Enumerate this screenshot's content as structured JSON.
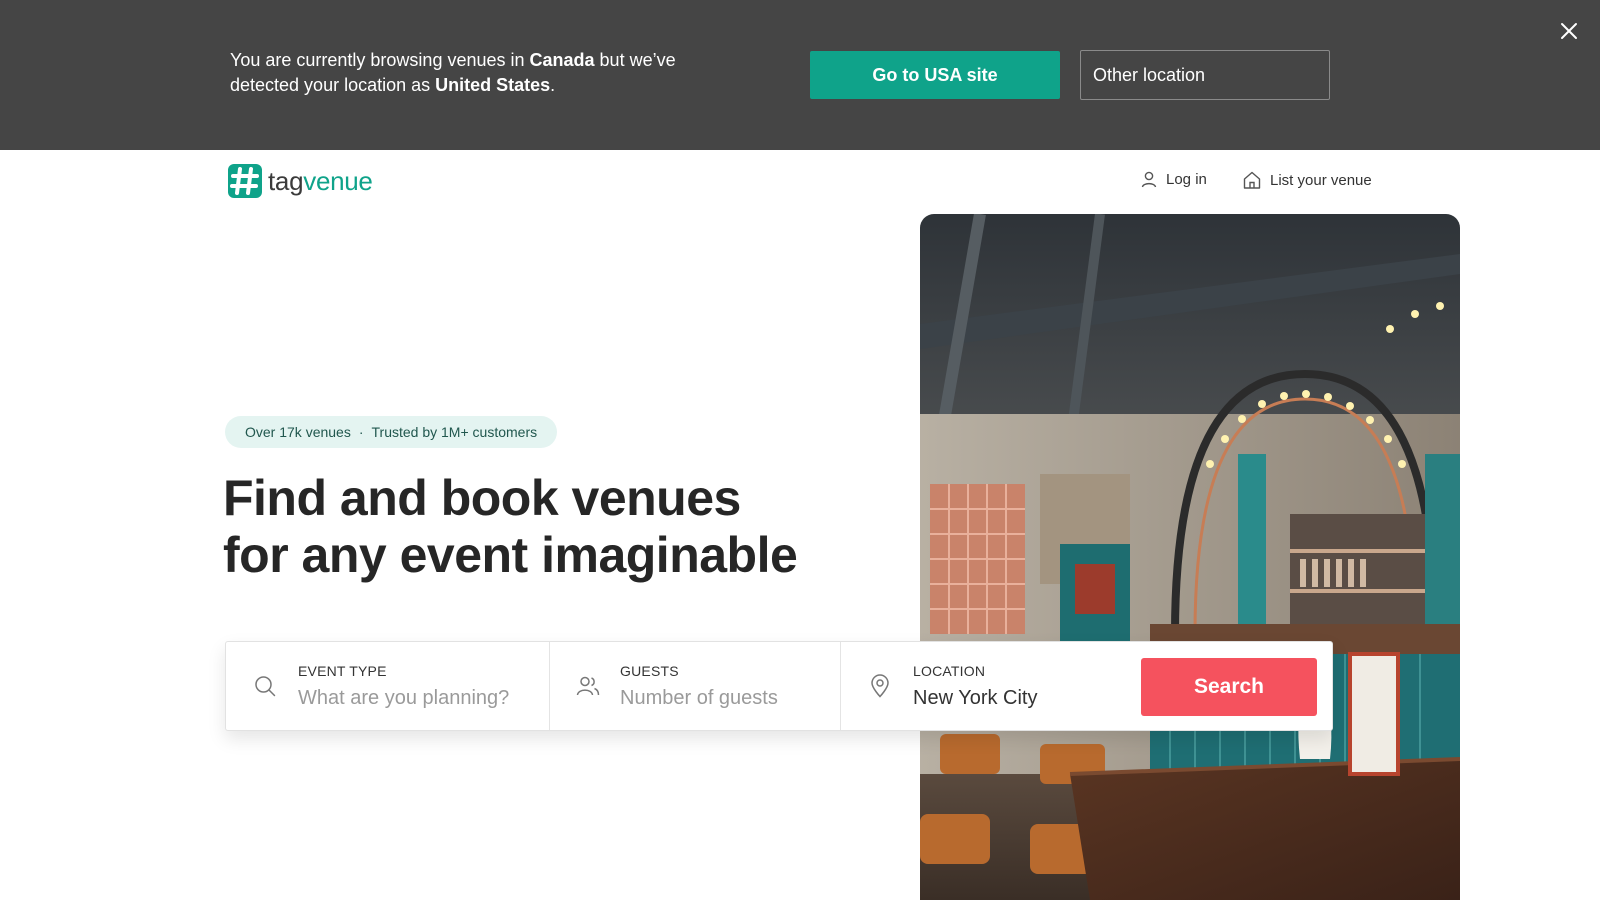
{
  "banner": {
    "message_prefix": "You are currently browsing venues in ",
    "current_region": "Canada",
    "message_middle": " but we’ve detected your location as ",
    "detected_region": "United States",
    "message_suffix": ".",
    "primary_button": "Go to USA site",
    "secondary_button": "Other location",
    "close_icon": "close-icon"
  },
  "header": {
    "logo": {
      "part1": "tag",
      "part2": "venue",
      "icon": "hash-logo-icon"
    },
    "nav": [
      {
        "label": "Log in",
        "icon": "user-icon"
      },
      {
        "label": "List your venue",
        "icon": "house-icon"
      }
    ]
  },
  "hero": {
    "badge_left": "Over 17k venues",
    "badge_sep": "·",
    "badge_right": "Trusted by 1M+ customers",
    "headline_line1": "Find and book venues",
    "headline_line2": "for any event imaginable",
    "image": "restaurant-bar-interior-photo"
  },
  "search": {
    "event_type": {
      "label": "EVENT TYPE",
      "placeholder": "What are you planning?",
      "value": "",
      "icon": "search-icon"
    },
    "guests": {
      "label": "GUESTS",
      "placeholder": "Number of guests",
      "value": "",
      "icon": "people-icon"
    },
    "location": {
      "label": "LOCATION",
      "placeholder": "",
      "value": "New York City",
      "icon": "location-pin-icon"
    },
    "button": "Search"
  },
  "colors": {
    "banner_bg": "#454545",
    "brand_teal": "#0fa38a",
    "search_red": "#f5525e",
    "badge_bg": "#e4f4f1"
  }
}
